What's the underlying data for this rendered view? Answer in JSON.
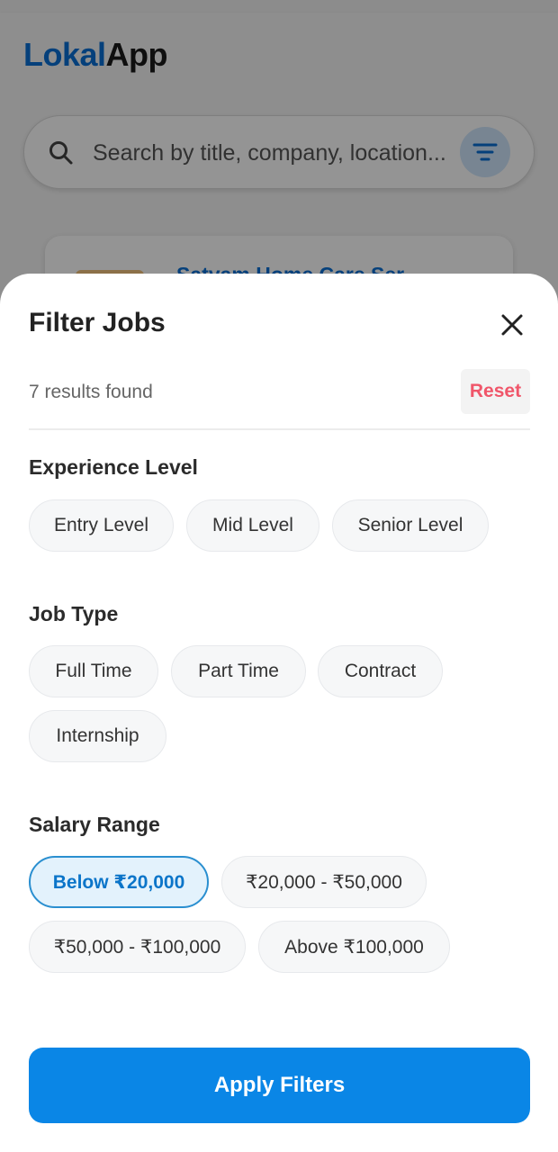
{
  "app": {
    "logo_brand": "Lokal",
    "logo_rest": "App",
    "search_placeholder": "Search by title, company, location...",
    "job_card_title": "Satyam Home Care Ser"
  },
  "sheet": {
    "title": "Filter Jobs",
    "results_text": "7 results found",
    "reset_label": "Reset",
    "apply_label": "Apply Filters",
    "sections": {
      "experience": {
        "title": "Experience Level",
        "options": [
          "Entry Level",
          "Mid Level",
          "Senior Level"
        ]
      },
      "job_type": {
        "title": "Job Type",
        "options": [
          "Full Time",
          "Part Time",
          "Contract",
          "Internship"
        ]
      },
      "salary": {
        "title": "Salary Range",
        "options": [
          "Below ₹20,000",
          "₹20,000 - ₹50,000",
          "₹50,000 - ₹100,000",
          "Above ₹100,000"
        ],
        "selected": "Below ₹20,000"
      }
    }
  },
  "colors": {
    "accent": "#0a86e6",
    "brand": "#0a6fd4",
    "reset": "#f0566a",
    "chip_selected_border": "#2a8fd0"
  },
  "icons": {
    "search": "search-icon",
    "filter": "filter-icon",
    "close": "close-icon"
  }
}
